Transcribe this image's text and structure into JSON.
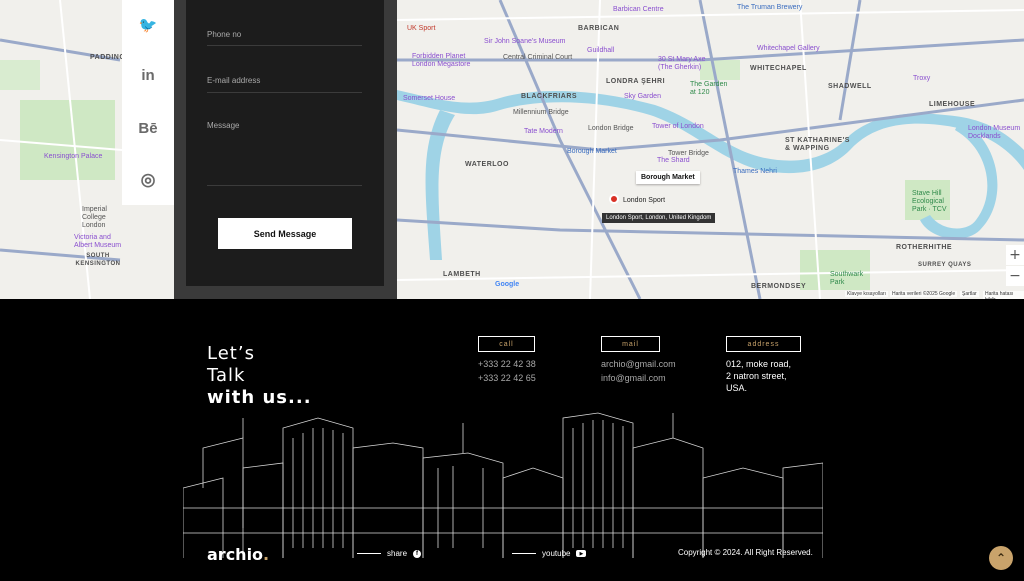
{
  "contact_form": {
    "phone_placeholder": "Phone no",
    "email_placeholder": "E-mail address",
    "message_placeholder": "Message",
    "send_label": "Send Message"
  },
  "social_sidebar": [
    {
      "icon": "twitter-icon",
      "glyph": "🐦"
    },
    {
      "icon": "linkedin-icon",
      "glyph": "in"
    },
    {
      "icon": "behance-icon",
      "glyph": "Bē"
    },
    {
      "icon": "dribbble-icon",
      "glyph": "◎"
    }
  ],
  "map": {
    "labels": {
      "barbican": "Barbican Centre",
      "truman": "The Truman Brewery",
      "uk_sport": "UK Sport",
      "soane": "Sir John Soane's Museum",
      "barbican_area": "BARBICAN",
      "forbidden": "Forbidden Planet London Megastore",
      "ccc": "Central Criminal Court",
      "guildhall": "Guildhall",
      "whitechapel_gallery": "Whitechapel Gallery",
      "whitechapel": "WHITECHAPEL",
      "londra": "LONDRA ŞEHRI",
      "gherkin": "30 St Mary Axe (The Gherkin)",
      "troxy": "Troxy",
      "somerset": "Somerset House",
      "blackfriars": "BLACKFRIARS",
      "skygarden": "Sky Garden",
      "garden120": "The Garden at 120",
      "shadwell": "SHADWELL",
      "limehouse": "LIMEHOUSE",
      "millennium": "Millennium Bridge",
      "london_bridge": "London Bridge",
      "tower_of_london": "Tower of London",
      "st_katharine": "ST KATHARINE'S & WAPPING",
      "tate": "Tate Modern",
      "borough_market": "Borough Market",
      "tower_bridge": "Tower Bridge",
      "shard": "The Shard",
      "waterloo": "WATERLOO",
      "thames_nehri": "Thames Nehri",
      "london_museum": "London Museum Docklands",
      "borough_tip": "Borough Market",
      "london_sport": "London Sport",
      "london_sport_full": "London Sport, London, United Kingdom",
      "stave_hill": "Stave Hill Ecological Park · TCV",
      "rotherhithe": "ROTHERHITHE",
      "lambeth": "LAMBETH",
      "bermondsey": "BERMONDSEY",
      "southwark_park": "Southwark Park",
      "surrey_quays": "SURREY QUAYS",
      "kensington_palace": "Kensington Palace",
      "imperial": "Imperial College London",
      "va": "Victoria and Albert Museum",
      "south_kensington": "SOUTH KENSINGTON",
      "paddington": "PADDINGTON",
      "google": "Google"
    },
    "attribution": {
      "shortcuts": "Klavye kısayolları",
      "data": "Harita verileri ©2025 Google",
      "terms": "Şartlar",
      "report": "Harita hatası bildir"
    },
    "zoom_in": "+",
    "zoom_out": "−"
  },
  "footer": {
    "talk_line1": "Let’s",
    "talk_line2": "Talk",
    "talk_line3": "with us...",
    "call_tag": "call",
    "mail_tag": "mail",
    "address_tag": "address",
    "phones": [
      "+333 22 42 38",
      "+333 22 42 65"
    ],
    "emails": [
      "archio@gmail.com",
      "info@gmail.com"
    ],
    "address": [
      "012, moke road,",
      "2 natron street,",
      "USA."
    ],
    "logo": "archio",
    "logo_dot": ".",
    "share_label": "share",
    "youtube_label": "youtube",
    "copyright": "Copyright © 2024. All Right Reserved.",
    "to_top": "⌃"
  },
  "colors": {
    "accent": "#c9a36b",
    "form_bg": "#1c1c1c",
    "thames": "#9fd3e6"
  }
}
